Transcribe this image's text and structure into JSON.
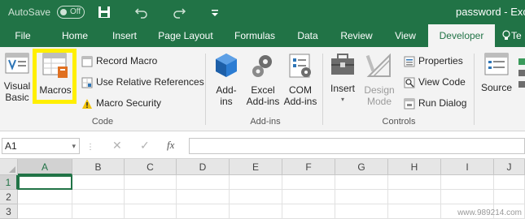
{
  "titlebar": {
    "autosave_label": "AutoSave",
    "autosave_state": "Off",
    "doc_title": "password - Exc",
    "icons": [
      "save-icon",
      "undo-icon",
      "redo-icon",
      "customize-toolbar-icon"
    ]
  },
  "tabs": [
    "File",
    "Home",
    "Insert",
    "Page Layout",
    "Formulas",
    "Data",
    "Review",
    "View",
    "Developer",
    "Te"
  ],
  "active_tab": "Developer",
  "ribbon": {
    "code": {
      "visual_basic": [
        "Visual",
        "Basic"
      ],
      "macros": "Macros",
      "record_macro": "Record Macro",
      "use_relative": "Use Relative References",
      "macro_security": "Macro Security",
      "label": "Code"
    },
    "addins": {
      "addins": [
        "Add-",
        "ins"
      ],
      "excel_addins": [
        "Excel",
        "Add-ins"
      ],
      "com_addins": [
        "COM",
        "Add-ins"
      ],
      "label": "Add-ins"
    },
    "controls": {
      "insert": "Insert",
      "design_mode": [
        "Design",
        "Mode"
      ],
      "properties": "Properties",
      "view_code": "View Code",
      "run_dialog": "Run Dialog",
      "label": "Controls"
    },
    "xml": {
      "source": "Source"
    }
  },
  "formula_bar": {
    "name_box": "A1",
    "cancel_glyph": "✕",
    "enter_glyph": "✓",
    "fx": "fx",
    "value": ""
  },
  "grid": {
    "columns": [
      "A",
      "B",
      "C",
      "D",
      "E",
      "F",
      "G",
      "H",
      "I",
      "J"
    ],
    "rows": [
      "1",
      "2",
      "3"
    ],
    "active_cell": "A1"
  },
  "watermark": "www.989214.com",
  "colors": {
    "excel_green": "#217346",
    "ribbon_bg": "#f3f3f3",
    "highlight": "#ffef00"
  }
}
